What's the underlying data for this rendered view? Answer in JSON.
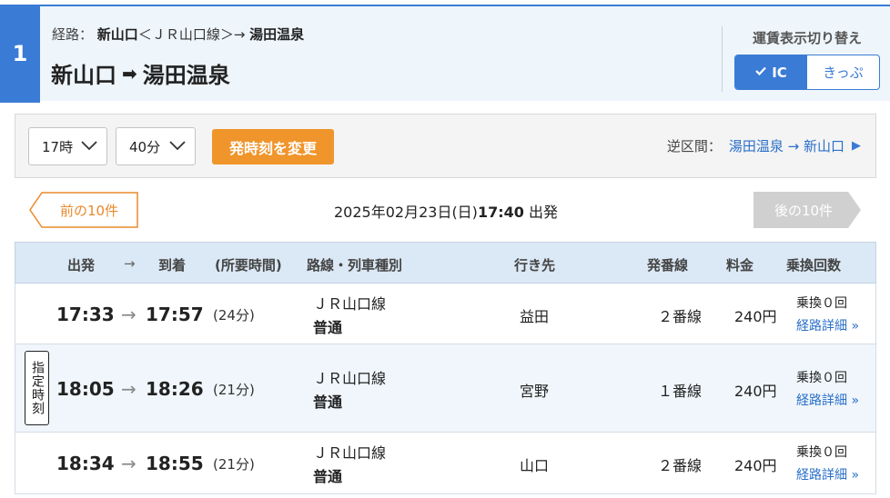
{
  "header": {
    "number": "1",
    "route_label": "経路：",
    "route_from": "新山口",
    "route_line": "＜ＪＲ山口線＞→",
    "route_to": "湯田温泉",
    "title_from": "新山口",
    "title_arrow": "➡",
    "title_to": "湯田温泉",
    "fare_toggle_title": "運賃表示切り替え",
    "fare_options": [
      "IC",
      "きっぷ"
    ],
    "fare_selected": "IC"
  },
  "controls": {
    "hour_value": "17時",
    "minute_value": "40分",
    "change_label": "発時刻を変更",
    "reverse_label": "逆区間：",
    "reverse_link": "湯田温泉 → 新山口"
  },
  "pager": {
    "prev_label": "前の10件",
    "next_label": "後の10件",
    "date_text": "2025年02月23日(日)",
    "time_text": "17:40",
    "dep_suffix": "出発"
  },
  "table": {
    "columns": {
      "dep": "出発",
      "arrow": "→",
      "arr": "到着",
      "dur": "(所要時間)",
      "line": "路線・列車種別",
      "dest": "行き先",
      "plat": "発番線",
      "fare": "料金",
      "xfer": "乗換回数"
    },
    "rows": [
      {
        "badge": "",
        "dep": "17:33",
        "arrow": "→",
        "arr": "17:57",
        "dur": "(24分)",
        "line": "ＪＲ山口線",
        "kind": "普通",
        "dest": "益田",
        "plat": "２番線",
        "fare": "240円",
        "xfer": "乗換０回",
        "detail": "経路詳細 »"
      },
      {
        "badge": "指定時刻",
        "dep": "18:05",
        "arrow": "→",
        "arr": "18:26",
        "dur": "(21分)",
        "line": "ＪＲ山口線",
        "kind": "普通",
        "dest": "宮野",
        "plat": "１番線",
        "fare": "240円",
        "xfer": "乗換０回",
        "detail": "経路詳細 »"
      },
      {
        "badge": "",
        "dep": "18:34",
        "arrow": "→",
        "arr": "18:55",
        "dur": "(21分)",
        "line": "ＪＲ山口線",
        "kind": "普通",
        "dest": "山口",
        "plat": "２番線",
        "fare": "240円",
        "xfer": "乗換０回",
        "detail": "経路詳細 »"
      }
    ]
  },
  "colors": {
    "accent": "#3a7bd5",
    "orange": "#f0952b",
    "link": "#2a6fc9",
    "header_bg": "#eef5fb",
    "table_head_bg": "#dbe8f5"
  },
  "icons": {
    "check": "check-icon",
    "chevron": "chevron-down-icon",
    "triangle": "triangle-right-icon"
  }
}
